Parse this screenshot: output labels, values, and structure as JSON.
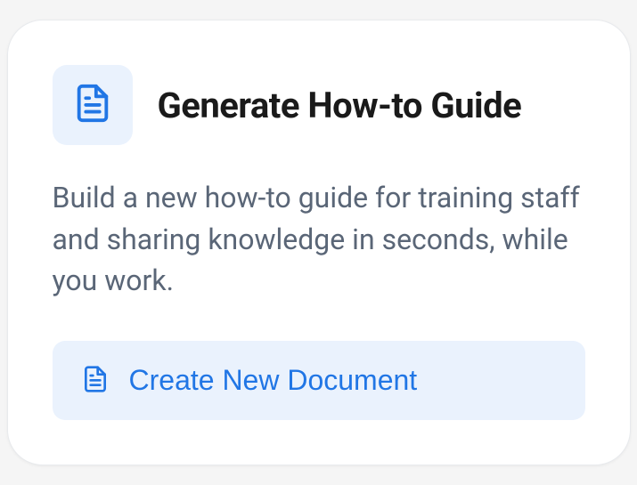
{
  "card": {
    "title": "Generate How-to Guide",
    "description": "Build a new how-to guide for training staff and sharing knowledge in seconds, while you work.",
    "button_label": "Create New Document"
  },
  "colors": {
    "accent": "#2176e5",
    "icon_bg": "#eaf2fd",
    "text_muted": "#5a6677"
  }
}
